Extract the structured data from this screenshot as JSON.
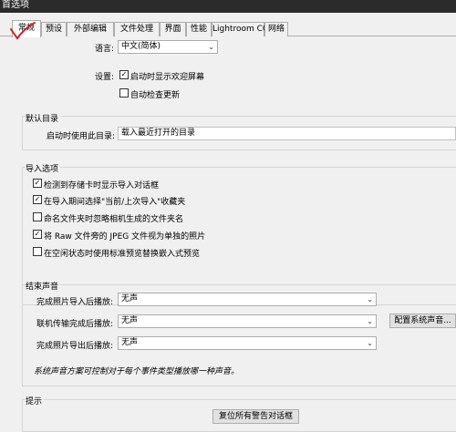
{
  "window": {
    "title": "首选项"
  },
  "tabs": [
    {
      "label": "常规"
    },
    {
      "label": "预设"
    },
    {
      "label": "外部编辑"
    },
    {
      "label": "文件处理"
    },
    {
      "label": "界面"
    },
    {
      "label": "性能"
    },
    {
      "label": "Lightroom CC"
    },
    {
      "label": "网络"
    }
  ],
  "language": {
    "label": "语言:",
    "value": "中文(简体)"
  },
  "settings": {
    "label": "设置:",
    "show_splash": {
      "label": "启动时显示欢迎屏幕",
      "checked": true
    },
    "auto_update": {
      "label": "自动检查更新",
      "checked": false
    }
  },
  "default_catalog": {
    "title": "默认目录",
    "label": "启动时使用此目录:",
    "value": "载入最近打开的目录"
  },
  "import_options": {
    "title": "导入选项",
    "items": [
      {
        "label": "检测到存储卡时显示导入对话框",
        "checked": true
      },
      {
        "label": "在导入期间选择\"当前/上次导入\"收藏夹",
        "checked": true
      },
      {
        "label": "命名文件夹时忽略相机生成的文件夹名",
        "checked": false
      },
      {
        "label": "将 Raw 文件旁的 JPEG 文件视为单独的照片",
        "checked": true
      },
      {
        "label": "在空闲状态时使用标准预览替换嵌入式预览",
        "checked": false
      }
    ]
  },
  "completion_sounds": {
    "title": "结束声音",
    "import_label": "完成照片导入后播放:",
    "import_value": "无声",
    "tether_label": "联机传输完成后播放:",
    "tether_value": "无声",
    "export_label": "完成照片导出后播放:",
    "export_value": "无声",
    "config_button": "配置系统声音...",
    "note": "系统声音方案可控制对于每个事件类型播放哪一种声音。"
  },
  "prompts": {
    "title": "提示",
    "reset_button": "复位所有警告对话框"
  },
  "colors": {
    "annotation": "#d21f1f",
    "window_bg": "#f0f0f0",
    "titlebar_bg": "#2b2b2b"
  }
}
